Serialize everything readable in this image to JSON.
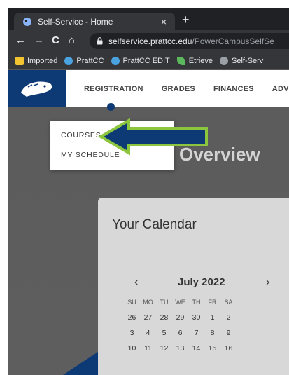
{
  "browser": {
    "tab_title": "Self-Service - Home",
    "tab_close": "×",
    "new_tab": "+",
    "back": "←",
    "forward": "→",
    "reload": "C",
    "home": "⌂",
    "url_host": "selfservice.prattcc.edu",
    "url_path": "/PowerCampusSelfSe"
  },
  "bookmarks": [
    {
      "label": "Imported",
      "icon": "folder-icon",
      "color": "#f4c430"
    },
    {
      "label": "PrattCC",
      "icon": "prattcc-icon",
      "color": "#4aa3df"
    },
    {
      "label": "PrattCC EDIT",
      "icon": "prattcc-icon",
      "color": "#4aa3df"
    },
    {
      "label": "Etrieve",
      "icon": "leaf-icon",
      "color": "#5cb85c"
    },
    {
      "label": "Self-Serv",
      "icon": "beaver-icon",
      "color": "#9aa0a6"
    }
  ],
  "nav": {
    "items": [
      "REGISTRATION",
      "GRADES",
      "FINANCES",
      "ADVIS"
    ]
  },
  "dropdown": {
    "items": [
      "COURSES",
      "MY SCHEDULE"
    ]
  },
  "page": {
    "heading": "Overview"
  },
  "calendar": {
    "title": "Your Calendar",
    "prev": "‹",
    "next": "›",
    "month": "July 2022",
    "weekdays": [
      "SU",
      "MO",
      "TU",
      "WE",
      "TH",
      "FR",
      "SA"
    ],
    "weeks": [
      [
        "26",
        "27",
        "28",
        "29",
        "30",
        "1",
        "2"
      ],
      [
        "3",
        "4",
        "5",
        "6",
        "7",
        "8",
        "9"
      ],
      [
        "10",
        "11",
        "12",
        "13",
        "14",
        "15",
        "16"
      ]
    ]
  },
  "colors": {
    "brand_navy": "#0d3a74",
    "arrow_fill": "#0d3a74",
    "arrow_outline": "#8cc63f"
  }
}
